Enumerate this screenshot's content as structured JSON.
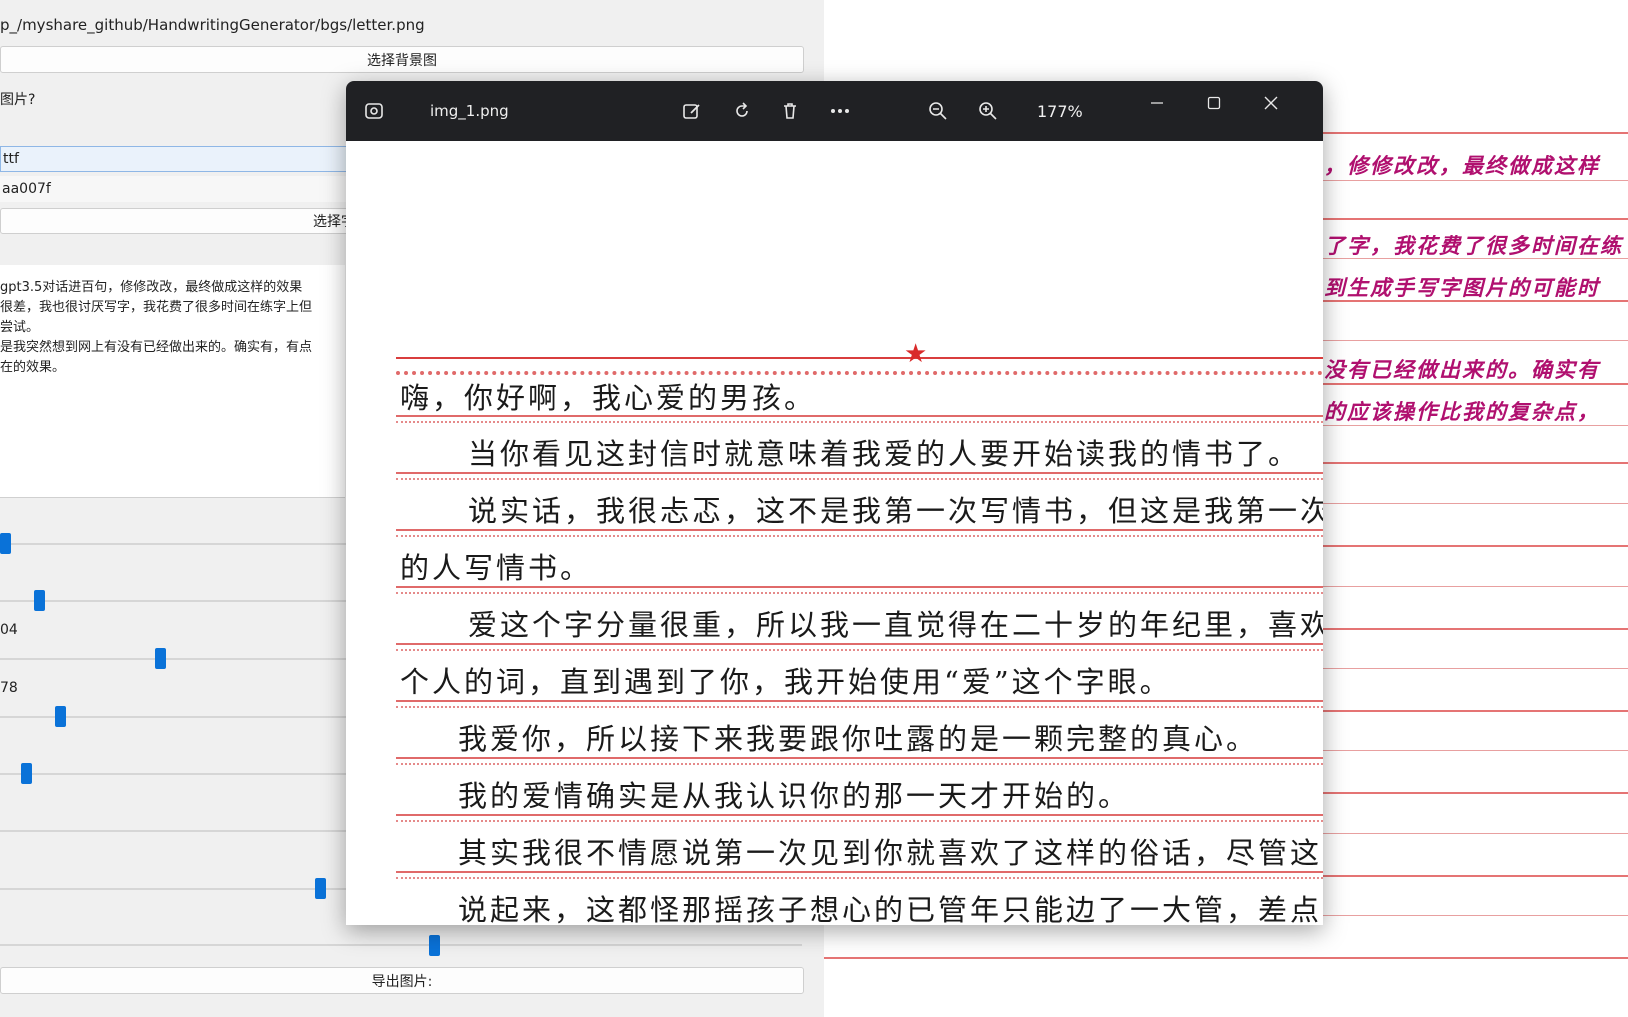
{
  "left_app": {
    "path_text": "p_/myshare_github/HandwritingGenerator/bgs/letter.png",
    "select_bg_button": "选择背景图",
    "question_label": "图片?",
    "font_field": "ttf",
    "color_field": "aa007f",
    "select_font_button": "选择字",
    "text_lines": [
      "gpt3.5对话进百句，修修改改，最终做成这样的效果",
      "很差，我也很讨厌写字，我花费了很多时间在练字上但",
      "尝试。",
      "是我突然想到网上有没有已经做出来的。确实有，有点",
      "在的效果。"
    ],
    "slider_values": [
      "04",
      "78"
    ],
    "export_button": "导出图片:"
  },
  "viewer": {
    "file_name": "img_1.png",
    "zoom": "177%",
    "icons": [
      "photo-icon",
      "edit-icon",
      "rotate-icon",
      "delete-icon",
      "more-icon",
      "zoom-out-icon",
      "zoom-in-icon",
      "minimize-icon",
      "maximize-icon",
      "close-icon"
    ],
    "letter_lines": [
      "嗨，你好啊，我心爱的男孩。",
      "当你看见这封信时就意味着我爱的人要开始读我的情书了。",
      "说实话，我很忐忑，这不是我第一次写情书，但这是我第一次给我",
      "的人写情书。",
      "爱这个字分量很重，所以我一直觉得在二十岁的年纪里，喜欢才是",
      "个人的词，直到遇到了你，我开始使用“爱”这个字眼。",
      "我爱你，所以接下来我要跟你吐露的是一颗完整的真心。",
      "我的爱情确实是从我认识你的那一天才开始的。",
      "其实我很不情愿说第一次见到你就喜欢了这样的俗话，尽管这是事",
      "说起来，这都怪那摇孩子想心的已管年只能边了一大管，差点害我"
    ]
  },
  "right_paper": {
    "lines": [
      "，修修改改，最终做成这样",
      "了字，我花费了很多时间在练",
      "到生成手写字图片的可能时",
      "没有已经做出来的。确实有",
      "的应该操作比我的复杂点，"
    ]
  },
  "colors": {
    "titlebar": "#202124",
    "accent_blue": "#0a72d8",
    "ruling_red": "#e06a6a",
    "handwriting_magenta": "#b0106f"
  }
}
